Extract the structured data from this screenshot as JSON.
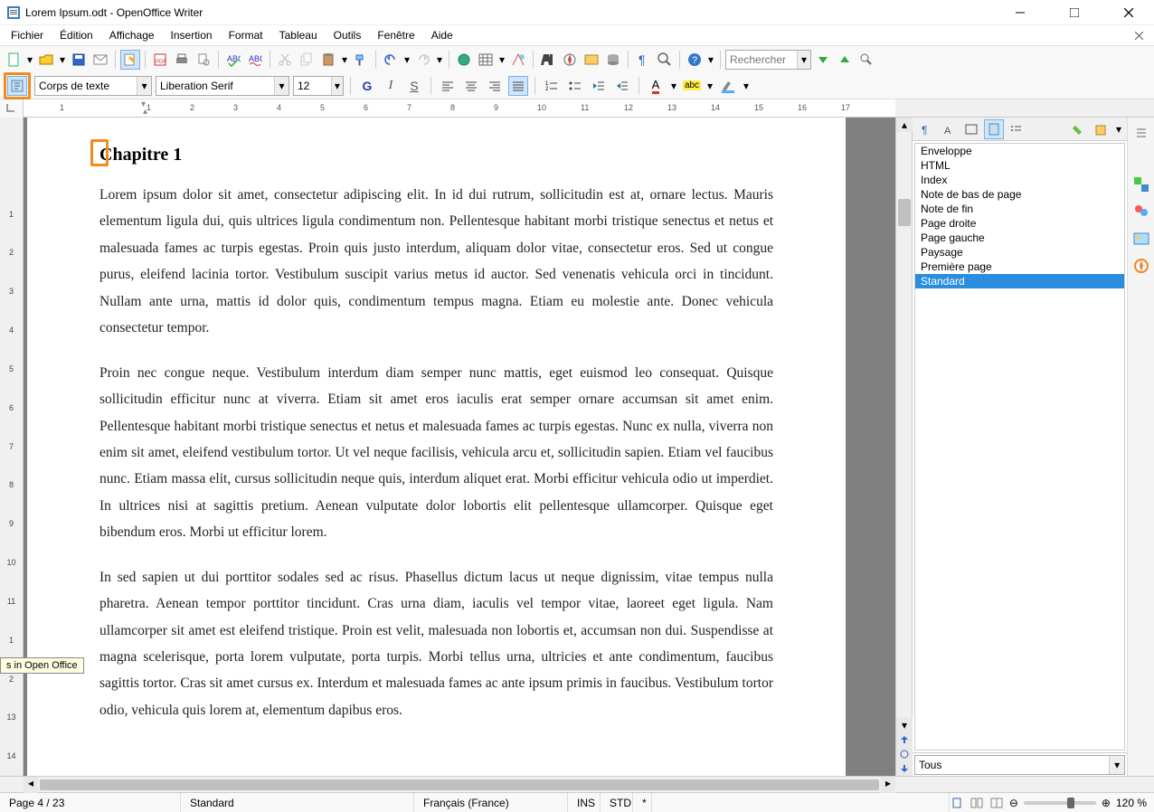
{
  "window": {
    "title": "Lorem Ipsum.odt - OpenOffice Writer"
  },
  "menu": [
    "Fichier",
    "Édition",
    "Affichage",
    "Insertion",
    "Format",
    "Tableau",
    "Outils",
    "Fenêtre",
    "Aide"
  ],
  "toolbar1": {
    "search_placeholder": "Rechercher"
  },
  "formatting": {
    "para_style": "Corps de texte",
    "font_name": "Liberation Serif",
    "font_size": "12"
  },
  "tooltip": "s in Open Office",
  "document": {
    "heading": "Chapitre 1",
    "p1": "Lorem ipsum dolor sit amet, consectetur adipiscing elit. In id dui rutrum, sollicitudin est at, ornare lectus. Mauris elementum ligula dui, quis ultrices ligula condimentum non. Pellentesque habitant morbi tristique senectus et netus et malesuada fames ac turpis egestas. Proin quis justo interdum, aliquam dolor vitae, consectetur eros. Sed ut congue purus, eleifend lacinia tortor. Vestibulum suscipit varius metus id auctor. Sed venenatis vehicula orci in tincidunt. Nullam ante urna, mattis id dolor quis, condimentum tempus magna. Etiam eu molestie ante. Donec vehicula consectetur tempor.",
    "p2": "Proin nec congue neque. Vestibulum interdum diam semper nunc mattis, eget euismod leo consequat. Quisque sollicitudin efficitur nunc at viverra. Etiam sit amet eros iaculis erat semper ornare accumsan sit amet enim. Pellentesque habitant morbi tristique senectus et netus et malesuada fames ac turpis egestas. Nunc ex nulla, viverra non enim sit amet, eleifend vestibulum tortor. Ut vel neque facilisis, vehicula arcu et, sollicitudin sapien. Etiam vel faucibus nunc. Etiam massa elit, cursus sollicitudin neque quis, interdum aliquet erat. Morbi efficitur vehicula odio ut imperdiet. In ultrices nisi at sagittis pretium. Aenean vulputate dolor lobortis elit pellentesque ullamcorper. Quisque eget bibendum eros. Morbi ut efficitur lorem.",
    "p3": "In sed sapien ut dui porttitor sodales sed ac risus. Phasellus dictum lacus ut neque dignissim, vitae tempus nulla pharetra. Aenean tempor porttitor tincidunt. Cras urna diam, iaculis vel tempor vitae, laoreet eget ligula. Nam ullamcorper sit amet est eleifend tristique. Proin est velit, malesuada non lobortis et, accumsan non dui. Suspendisse at magna scelerisque, porta lorem vulputate, porta turpis. Morbi tellus urna, ultricies et ante condimentum, faucibus sagittis tortor. Cras sit amet cursus ex. Interdum et malesuada fames ac ante ipsum primis in faucibus. Vestibulum tortor odio, vehicula quis lorem at, elementum dapibus eros."
  },
  "ruler_h": [
    "1",
    "",
    "1",
    "2",
    "3",
    "4",
    "5",
    "6",
    "7",
    "8",
    "9",
    "10",
    "11",
    "12",
    "13",
    "14",
    "15",
    "16",
    "17"
  ],
  "ruler_v": [
    "",
    "",
    "1",
    "2",
    "3",
    "4",
    "5",
    "6",
    "7",
    "8",
    "9",
    "10",
    "11",
    "1",
    "2",
    "13",
    "14"
  ],
  "sidebar": {
    "items": [
      "Enveloppe",
      "HTML",
      "Index",
      "Note de bas de page",
      "Note de fin",
      "Page droite",
      "Page gauche",
      "Paysage",
      "Première page",
      "Standard"
    ],
    "selected_index": 9,
    "filter": "Tous"
  },
  "status": {
    "page": "Page 4 / 23",
    "style": "Standard",
    "lang": "Français (France)",
    "ins": "INS",
    "std": "STD",
    "mod": "*",
    "zoom": "120 %"
  }
}
